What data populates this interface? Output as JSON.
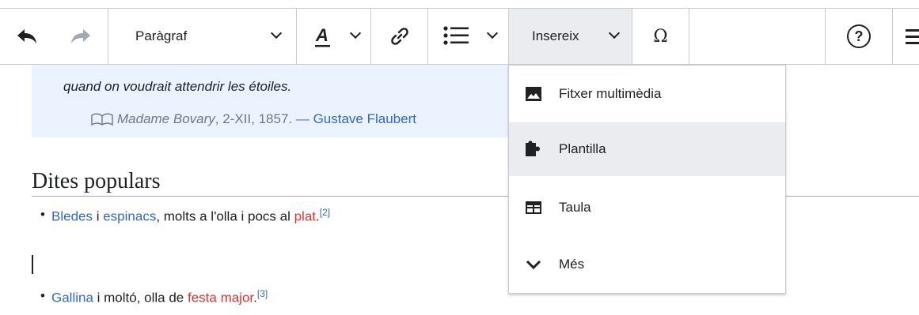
{
  "toolbar": {
    "undo_icon": "undo-icon",
    "redo_icon": "redo-icon",
    "format_label": "Paràgraf",
    "text_style_icon": "text-style-icon",
    "link_icon": "link-icon",
    "list_icon": "list-icon",
    "insert_label": "Insereix",
    "special_char_label": "Ω",
    "help_label": "?",
    "menu_icon": "hamburger-icon"
  },
  "content": {
    "quote_text": "quand on voudrait attendrir les étoiles.",
    "cite_work": "Madame Bovary",
    "cite_rest": ", 2-XII, 1857. — ",
    "cite_author": "Gustave Flaubert",
    "heading": "Dites populars",
    "item1": {
      "part1": "Bledes",
      "part2": " i ",
      "part3": "espinacs",
      "part4": ", molts a l'olla i pocs al ",
      "part5": "plat",
      "part6": ".",
      "ref": "[2]"
    },
    "item2": {
      "part1": "Gallina",
      "part2": " i moltó, olla de ",
      "part3": "festa major",
      "part4": ".",
      "ref": "[3]"
    }
  },
  "insert_menu": {
    "items": [
      {
        "label": "Fitxer multimèdia",
        "icon": "image-icon"
      },
      {
        "label": "Plantilla",
        "icon": "puzzle-icon"
      },
      {
        "label": "Taula",
        "icon": "table-icon"
      },
      {
        "label": "Més",
        "icon": "chevron-down-icon"
      }
    ]
  },
  "colors": {
    "link": "#3366cc",
    "redlink": "#dd3333",
    "quote_bg": "#eaf3ff",
    "hover_bg": "#eaecf0"
  }
}
